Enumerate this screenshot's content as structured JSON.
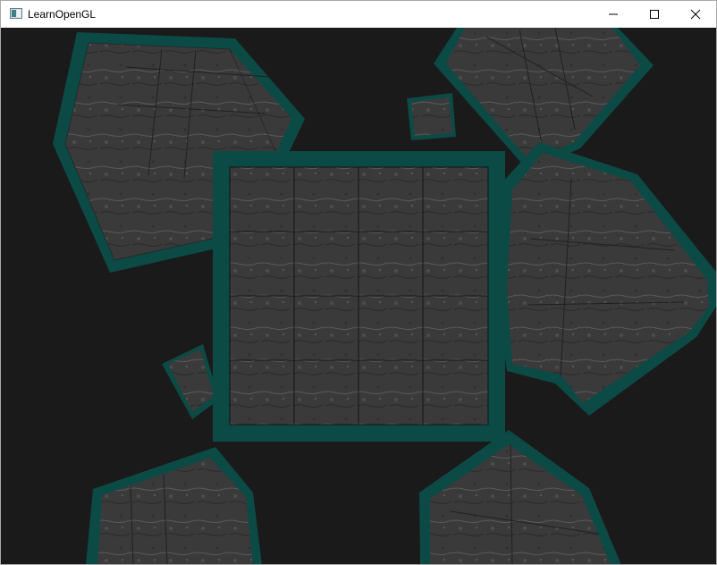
{
  "window": {
    "title": "LearnOpenGL",
    "controls": {
      "minimize": "minimize",
      "maximize": "maximize",
      "close": "close"
    }
  },
  "scene": {
    "background_color": "#1a1a1a",
    "outline_color": "#0b4a45",
    "crate_color": "#3b3b3b",
    "description_hidden": true
  }
}
